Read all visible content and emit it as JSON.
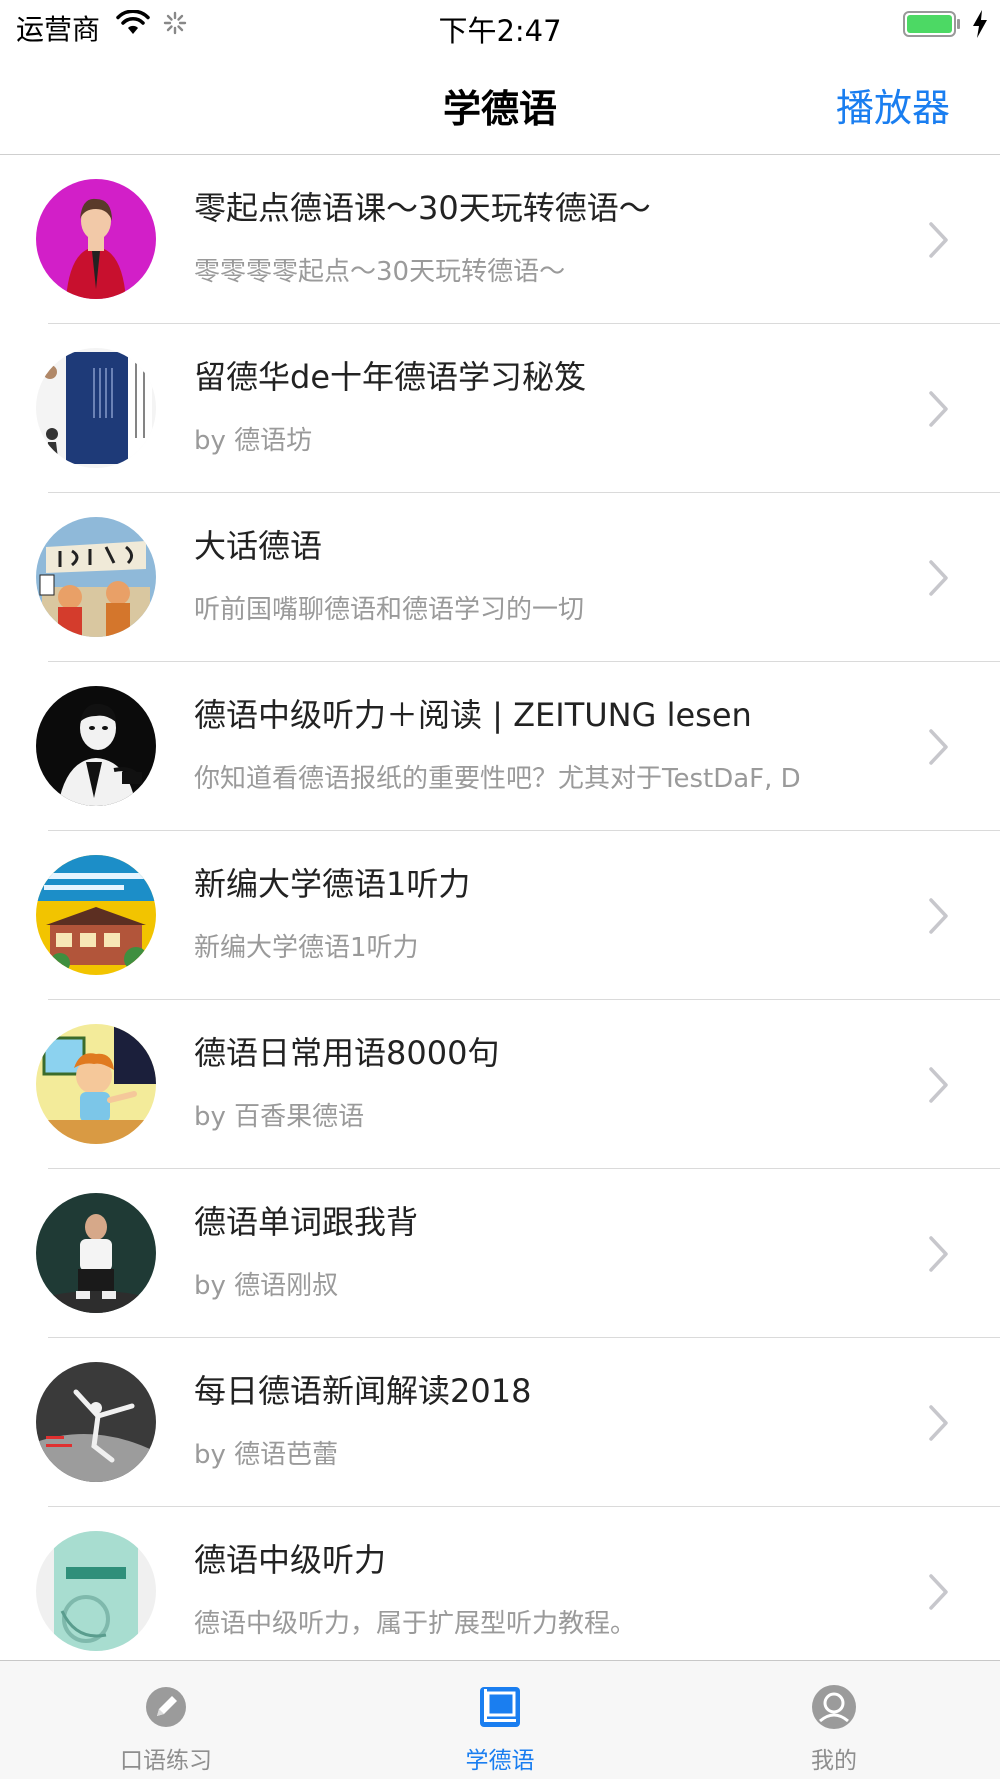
{
  "status_bar": {
    "carrier": "运营商",
    "time": "下午2:47"
  },
  "nav": {
    "title": "学德语",
    "right_button": "播放器"
  },
  "accent_color": "#1a7ef0",
  "list": [
    {
      "title": "零起点德语课～30天玩转德语～",
      "subtitle": "零零零零起点～30天玩转德语～",
      "thumb_icon": "woman-red-jacket-thumbnail"
    },
    {
      "title": "留德华de十年德语学习秘笈",
      "subtitle": "by 德语坊",
      "thumb_icon": "book-cover-thumbnail"
    },
    {
      "title": "大话德语",
      "subtitle": "听前国嘴聊德语和德语学习的一切",
      "thumb_icon": "cartoon-podcast-thumbnail"
    },
    {
      "title": "德语中级听力＋阅读 | ZEITUNG lesen",
      "subtitle": "你知道看德语报纸的重要性吧？尤其对于TestDaF, D",
      "thumb_icon": "bw-portrait-thumbnail"
    },
    {
      "title": "新编大学德语1听力",
      "subtitle": "新编大学德语1听力",
      "thumb_icon": "textbook-cover-thumbnail"
    },
    {
      "title": "德语日常用语8000句",
      "subtitle": "by 百香果德语",
      "thumb_icon": "cartoon-boy-thumbnail"
    },
    {
      "title": "德语单词跟我背",
      "subtitle": "by 德语刚叔",
      "thumb_icon": "man-photo-thumbnail"
    },
    {
      "title": "每日德语新闻解读2018",
      "subtitle": "by 德语芭蕾",
      "thumb_icon": "ballet-dancer-thumbnail"
    },
    {
      "title": "德语中级听力",
      "subtitle": "德语中级听力，属于扩展型听力教程。",
      "thumb_icon": "green-book-thumbnail"
    }
  ],
  "tabs": [
    {
      "label": "口语练习",
      "icon": "pencil-icon",
      "active": false
    },
    {
      "label": "学德语",
      "icon": "book-icon",
      "active": true
    },
    {
      "label": "我的",
      "icon": "profile-icon",
      "active": false
    }
  ]
}
